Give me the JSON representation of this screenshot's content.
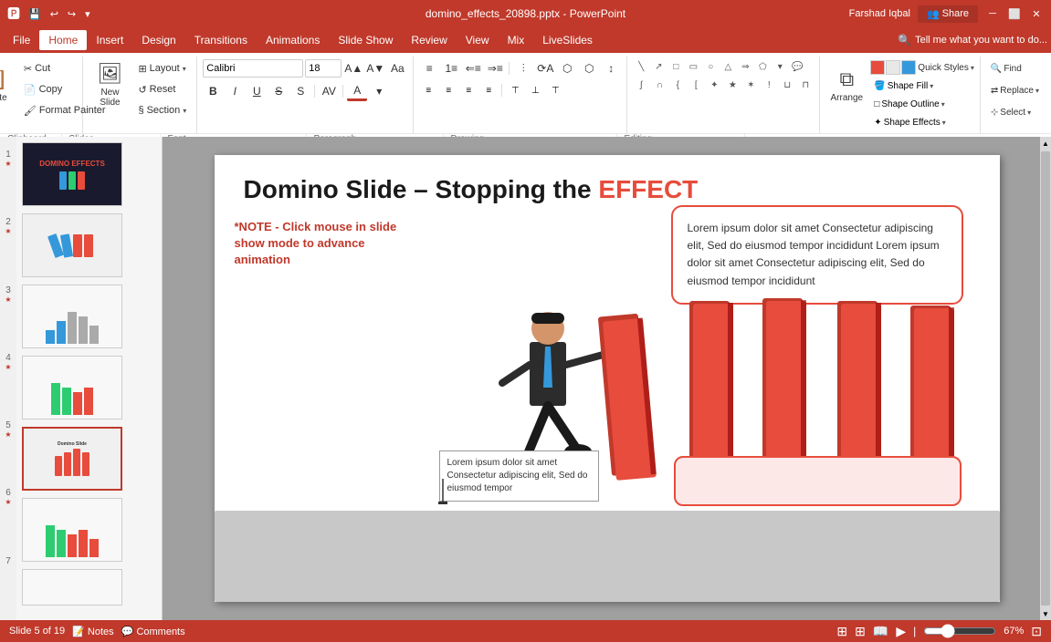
{
  "titlebar": {
    "filename": "domino_effects_20898.pptx - PowerPoint",
    "user": "Farshad Iqbal",
    "share_label": "Share"
  },
  "quickaccess": {
    "save": "💾",
    "undo": "↩",
    "redo": "↪",
    "customize": "▾"
  },
  "tabs": [
    {
      "label": "File",
      "active": false
    },
    {
      "label": "Home",
      "active": true
    },
    {
      "label": "Insert",
      "active": false
    },
    {
      "label": "Design",
      "active": false
    },
    {
      "label": "Transitions",
      "active": false
    },
    {
      "label": "Animations",
      "active": false
    },
    {
      "label": "Slide Show",
      "active": false
    },
    {
      "label": "Review",
      "active": false
    },
    {
      "label": "View",
      "active": false
    },
    {
      "label": "Mix",
      "active": false
    },
    {
      "label": "LiveSlides",
      "active": false
    }
  ],
  "ribbon": {
    "clipboard_label": "Clipboard",
    "slides_label": "Slides",
    "font_label": "Font",
    "paragraph_label": "Paragraph",
    "drawing_label": "Drawing",
    "editing_label": "Editing",
    "paste_label": "Paste",
    "new_slide_label": "New\nSlide",
    "layout_label": "Layout",
    "reset_label": "Reset",
    "section_label": "Section",
    "font_face": "Calibri",
    "font_size": "18",
    "bold": "B",
    "italic": "I",
    "underline": "U",
    "strikethrough": "S",
    "arrange_label": "Arrange",
    "quick_styles_label": "Quick Styles",
    "shape_fill_label": "Shape Fill",
    "shape_outline_label": "Shape Outline",
    "shape_effects_label": "Shape Effects",
    "find_label": "Find",
    "replace_label": "Replace",
    "select_label": "Select"
  },
  "slide": {
    "title_plain": "Domino Slide – Stopping the ",
    "title_highlight": "EFFECT",
    "note_text": "*NOTE - Click mouse in slide show mode to advance animation",
    "lorem_main": "Lorem ipsum dolor sit amet Consectetur adipiscing elit, Sed do eiusmod tempor incididunt Lorem ipsum dolor sit amet Consectetur adipiscing elit, Sed do eiusmod tempor incididunt",
    "lorem_lower": "Lorem ipsum dolor sit amet Consectetur adipiscing elit, Sed do eiusmod tempor",
    "lorem_small": "Lorem ipsum dolor sit amet Consectetur adipiscing elit, Sed do eiusmod tempor"
  },
  "statusbar": {
    "slide_info": "Slide 5 of 19",
    "notes_label": "Notes",
    "comments_label": "Comments",
    "zoom": "67%",
    "zoom_value": 67
  },
  "tell_me": "Tell me what you want to do...",
  "slide_thumbnails": [
    {
      "num": "1",
      "star": true,
      "active": false
    },
    {
      "num": "2",
      "star": true,
      "active": false
    },
    {
      "num": "3",
      "star": true,
      "active": false
    },
    {
      "num": "4",
      "star": true,
      "active": false
    },
    {
      "num": "5",
      "star": true,
      "active": true
    },
    {
      "num": "6",
      "star": true,
      "active": false
    },
    {
      "num": "7",
      "star": false,
      "active": false
    }
  ]
}
